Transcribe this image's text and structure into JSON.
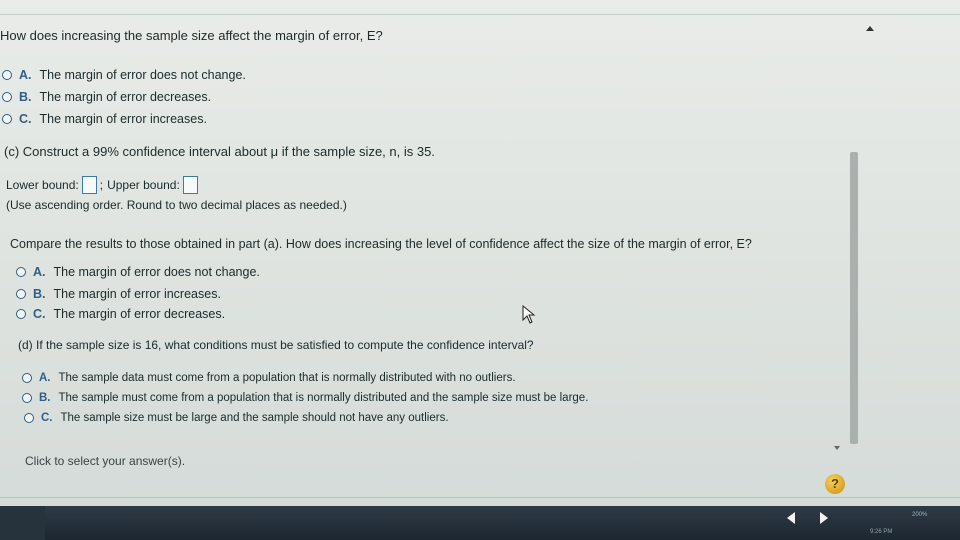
{
  "part_b": {
    "question": "How does increasing the sample size affect the margin of error, E?",
    "options": [
      {
        "letter": "A.",
        "text": "The margin of error does not change."
      },
      {
        "letter": "B.",
        "text": "The margin of error decreases."
      },
      {
        "letter": "C.",
        "text": "The margin of error increases."
      }
    ]
  },
  "part_c": {
    "question": "(c) Construct a 99% confidence interval about μ if the sample size, n, is 35.",
    "lower_label": "Lower bound:",
    "separator": ";",
    "upper_label": "Upper bound:",
    "instruction": "(Use ascending order. Round to two decimal places as needed.)",
    "compare_question": "Compare the results to those obtained in part (a). How does increasing the level of confidence affect the size of the margin of error, E?",
    "options": [
      {
        "letter": "A.",
        "text": "The margin of error does not change."
      },
      {
        "letter": "B.",
        "text": "The margin of error increases."
      },
      {
        "letter": "C.",
        "text": "The margin of error decreases."
      }
    ]
  },
  "part_d": {
    "question": "(d) If the sample size is 16, what conditions must be satisfied to compute the confidence interval?",
    "options": [
      {
        "letter": "A.",
        "text": "The sample data must come from a population that is normally distributed with no outliers."
      },
      {
        "letter": "B.",
        "text": "The sample must come from a population that is normally distributed and the sample size must be large."
      },
      {
        "letter": "C.",
        "text": "The sample size must be large and the sample should not have any outliers."
      }
    ]
  },
  "footer": {
    "hint": "Click to select your answer(s).",
    "help_label": "?",
    "zoom": "200%",
    "clock": "9:26 PM"
  },
  "colors": {
    "accent": "#2f5e86",
    "help": "#e0ad2c"
  }
}
